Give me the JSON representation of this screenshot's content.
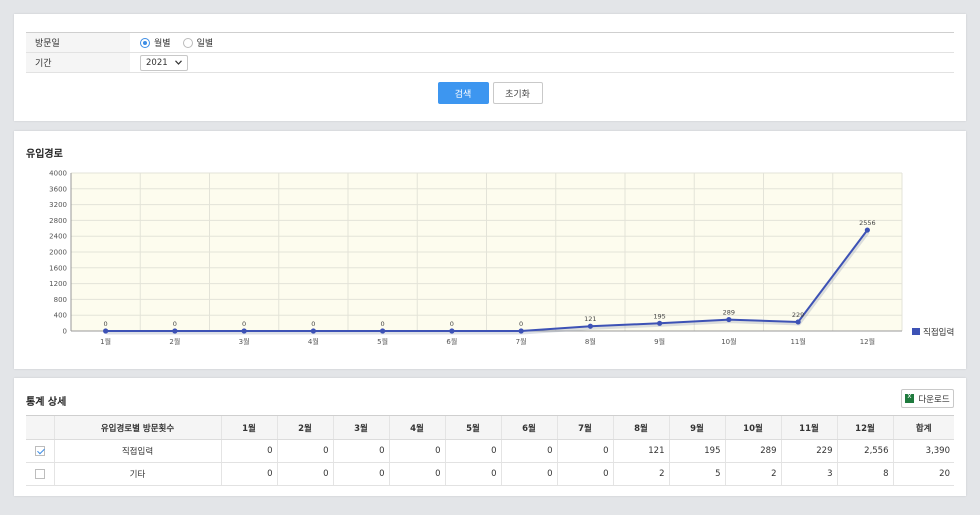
{
  "filter": {
    "visit_label": "방문일",
    "period_label": "기간",
    "radio_monthly": "월별",
    "radio_daily": "일별",
    "selected_mode": "monthly",
    "year_value": "2021",
    "search_button": "검색",
    "reset_button": "초기화"
  },
  "chart_section": {
    "title": "유입경로"
  },
  "chart_data": {
    "type": "line",
    "categories": [
      "1월",
      "2월",
      "3월",
      "4월",
      "5월",
      "6월",
      "7월",
      "8월",
      "9월",
      "10월",
      "11월",
      "12월"
    ],
    "series": [
      {
        "name": "직접입력",
        "values": [
          0,
          0,
          0,
          0,
          0,
          0,
          0,
          121,
          195,
          289,
          229,
          2556
        ],
        "color": "#3d52b5"
      }
    ],
    "y_ticks": [
      0,
      400,
      800,
      1200,
      1600,
      2000,
      2400,
      2800,
      3200,
      3600,
      4000
    ],
    "ylim": [
      0,
      4000
    ],
    "grid": true,
    "legend": "right",
    "plot_background": "#fdfcee"
  },
  "detail": {
    "title": "통계 상세",
    "download_label": "다운로드",
    "headers": [
      "",
      "유입경로별 방문횟수",
      "1월",
      "2월",
      "3월",
      "4월",
      "5월",
      "6월",
      "7월",
      "8월",
      "9월",
      "10월",
      "11월",
      "12월",
      "합계"
    ],
    "rows": [
      {
        "checked": true,
        "name": "직접입력",
        "values": [
          "0",
          "0",
          "0",
          "0",
          "0",
          "0",
          "0",
          "121",
          "195",
          "289",
          "229",
          "2,556",
          "3,390"
        ]
      },
      {
        "checked": false,
        "name": "기타",
        "values": [
          "0",
          "0",
          "0",
          "0",
          "0",
          "0",
          "0",
          "2",
          "5",
          "2",
          "3",
          "8",
          "20"
        ]
      }
    ]
  },
  "colors": {
    "accent": "#3d96f0",
    "line": "#3d52b5"
  }
}
